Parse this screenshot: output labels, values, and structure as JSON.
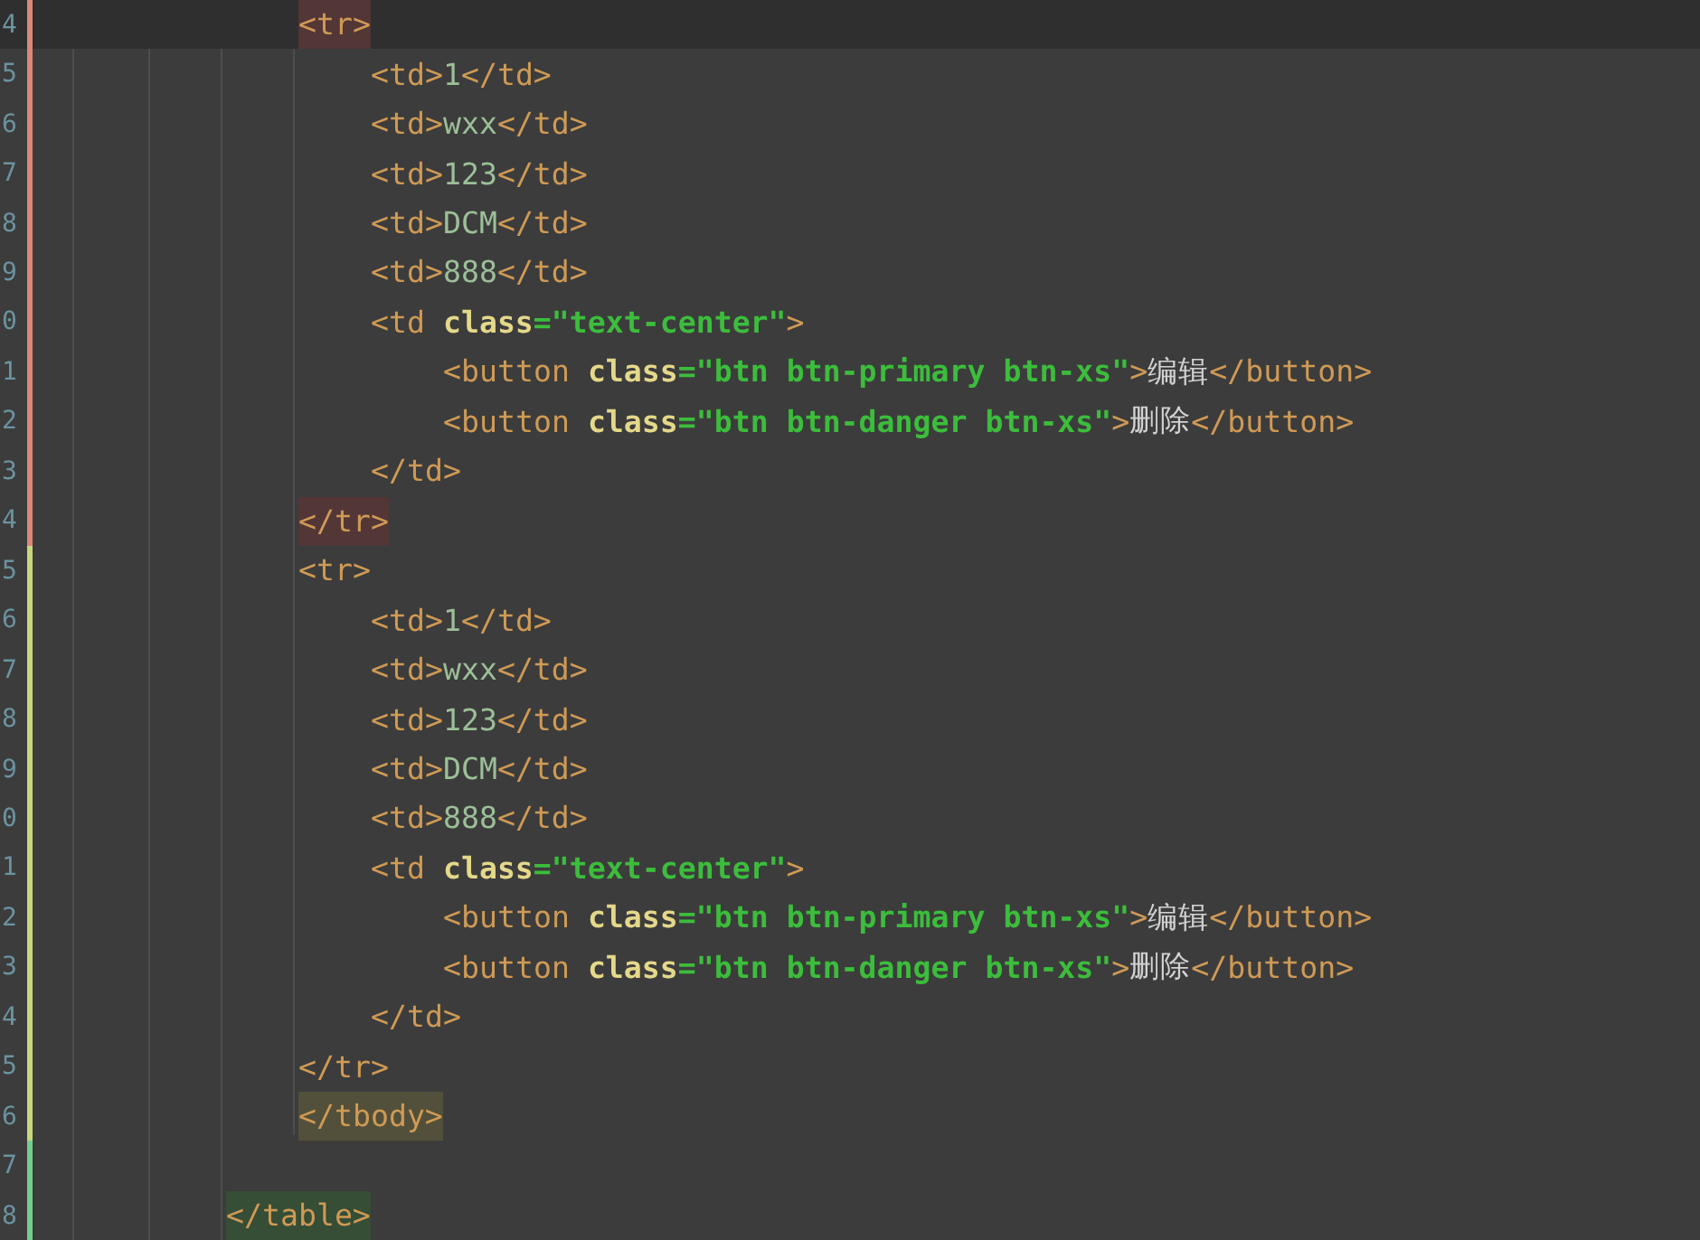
{
  "lines": [
    {
      "children": [
        {
          "number": "4",
          "color": "#d9887a",
          "current": true,
          "highlight": {
            "color": "#533636"
          },
          "tokens": [
            {
              "kind": "tag",
              "text": "<tr>"
            }
          ],
          "children": [
            {
              "number": "5",
              "color": "#d9887a",
              "current": false,
              "tokens": [
                {
                  "kind": "tag",
                  "text": "<td>"
                },
                {
                  "kind": "text",
                  "text": "1"
                },
                {
                  "kind": "tag",
                  "text": "</td>"
                }
              ]
            },
            {
              "number": "6",
              "color": "#d9887a",
              "current": false,
              "tokens": [
                {
                  "kind": "tag",
                  "text": "<td>"
                },
                {
                  "kind": "text",
                  "text": "wxx"
                },
                {
                  "kind": "tag",
                  "text": "</td>"
                }
              ]
            },
            {
              "number": "7",
              "color": "#d9887a",
              "current": false,
              "tokens": [
                {
                  "kind": "tag",
                  "text": "<td>"
                },
                {
                  "kind": "text",
                  "text": "123"
                },
                {
                  "kind": "tag",
                  "text": "</td>"
                }
              ]
            },
            {
              "number": "8",
              "color": "#d9887a",
              "current": false,
              "tokens": [
                {
                  "kind": "tag",
                  "text": "<td>"
                },
                {
                  "kind": "text",
                  "text": "DCM"
                },
                {
                  "kind": "tag",
                  "text": "</td>"
                }
              ]
            },
            {
              "number": "9",
              "color": "#d9887a",
              "current": false,
              "tokens": [
                {
                  "kind": "tag",
                  "text": "<td>"
                },
                {
                  "kind": "text",
                  "text": "888"
                },
                {
                  "kind": "tag",
                  "text": "</td>"
                }
              ]
            },
            {
              "number": "0",
              "color": "#d9887a",
              "current": false,
              "tokens": [
                {
                  "kind": "tag",
                  "text": "<td "
                },
                {
                  "kind": "attr",
                  "text": "class"
                },
                {
                  "kind": "string",
                  "text": "=\"text-center\""
                },
                {
                  "kind": "tag",
                  "text": ">"
                }
              ],
              "children": [
                {
                  "number": "1",
                  "color": "#d9887a",
                  "current": false,
                  "tokens": [
                    {
                      "kind": "tag",
                      "text": "<button "
                    },
                    {
                      "kind": "attr",
                      "text": "class"
                    },
                    {
                      "kind": "string",
                      "text": "=\"btn btn-primary btn-xs\""
                    },
                    {
                      "kind": "tag",
                      "text": ">"
                    },
                    {
                      "kind": "plain",
                      "text": "编辑"
                    },
                    {
                      "kind": "tag",
                      "text": "</button>"
                    }
                  ]
                },
                {
                  "number": "2",
                  "color": "#d9887a",
                  "current": false,
                  "tokens": [
                    {
                      "kind": "tag",
                      "text": "<button "
                    },
                    {
                      "kind": "attr",
                      "text": "class"
                    },
                    {
                      "kind": "string",
                      "text": "=\"btn btn-danger btn-xs\""
                    },
                    {
                      "kind": "tag",
                      "text": ">"
                    },
                    {
                      "kind": "plain",
                      "text": "删除"
                    },
                    {
                      "kind": "tag",
                      "text": "</button>"
                    }
                  ]
                }
              ]
            },
            {
              "number": "3",
              "color": "#d9887a",
              "current": false,
              "tokens": [
                {
                  "kind": "tag",
                  "text": "</td>"
                }
              ]
            }
          ]
        },
        {
          "number": "4",
          "color": "#d9887a",
          "current": false,
          "highlight": {
            "color": "#533636"
          },
          "tokens": [
            {
              "kind": "tag",
              "text": "</tr>"
            }
          ]
        },
        {
          "number": "5",
          "color": "#c9d67a",
          "current": false,
          "tokens": [
            {
              "kind": "tag",
              "text": "<tr>"
            }
          ],
          "children": [
            {
              "number": "6",
              "color": "#c9d67a",
              "current": false,
              "tokens": [
                {
                  "kind": "tag",
                  "text": "<td>"
                },
                {
                  "kind": "text",
                  "text": "1"
                },
                {
                  "kind": "tag",
                  "text": "</td>"
                }
              ]
            },
            {
              "number": "7",
              "color": "#c9d67a",
              "current": false,
              "tokens": [
                {
                  "kind": "tag",
                  "text": "<td>"
                },
                {
                  "kind": "text",
                  "text": "wxx"
                },
                {
                  "kind": "tag",
                  "text": "</td>"
                }
              ]
            },
            {
              "number": "8",
              "color": "#c9d67a",
              "current": false,
              "tokens": [
                {
                  "kind": "tag",
                  "text": "<td>"
                },
                {
                  "kind": "text",
                  "text": "123"
                },
                {
                  "kind": "tag",
                  "text": "</td>"
                }
              ]
            },
            {
              "number": "9",
              "color": "#c9d67a",
              "current": false,
              "tokens": [
                {
                  "kind": "tag",
                  "text": "<td>"
                },
                {
                  "kind": "text",
                  "text": "DCM"
                },
                {
                  "kind": "tag",
                  "text": "</td>"
                }
              ]
            },
            {
              "number": "0",
              "color": "#c9d67a",
              "current": false,
              "tokens": [
                {
                  "kind": "tag",
                  "text": "<td>"
                },
                {
                  "kind": "text",
                  "text": "888"
                },
                {
                  "kind": "tag",
                  "text": "</td>"
                }
              ]
            },
            {
              "number": "1",
              "color": "#c9d67a",
              "current": false,
              "tokens": [
                {
                  "kind": "tag",
                  "text": "<td "
                },
                {
                  "kind": "attr",
                  "text": "class"
                },
                {
                  "kind": "string",
                  "text": "=\"text-center\""
                },
                {
                  "kind": "tag",
                  "text": ">"
                }
              ],
              "children": [
                {
                  "number": "2",
                  "color": "#c9d67a",
                  "current": false,
                  "tokens": [
                    {
                      "kind": "tag",
                      "text": "<button "
                    },
                    {
                      "kind": "attr",
                      "text": "class"
                    },
                    {
                      "kind": "string",
                      "text": "=\"btn btn-primary btn-xs\""
                    },
                    {
                      "kind": "tag",
                      "text": ">"
                    },
                    {
                      "kind": "plain",
                      "text": "编辑"
                    },
                    {
                      "kind": "tag",
                      "text": "</button>"
                    }
                  ]
                },
                {
                  "number": "3",
                  "color": "#c9d67a",
                  "current": false,
                  "tokens": [
                    {
                      "kind": "tag",
                      "text": "<button "
                    },
                    {
                      "kind": "attr",
                      "text": "class"
                    },
                    {
                      "kind": "string",
                      "text": "=\"btn btn-danger btn-xs\""
                    },
                    {
                      "kind": "tag",
                      "text": ">"
                    },
                    {
                      "kind": "plain",
                      "text": "删除"
                    },
                    {
                      "kind": "tag",
                      "text": "</button>"
                    }
                  ]
                }
              ]
            },
            {
              "number": "4",
              "color": "#c9d67a",
              "current": false,
              "tokens": [
                {
                  "kind": "tag",
                  "text": "</td>"
                }
              ]
            }
          ]
        },
        {
          "number": "5",
          "color": "#c9d67a",
          "current": false,
          "tokens": [
            {
              "kind": "tag",
              "text": "</tr>"
            }
          ]
        },
        {
          "number": "6",
          "color": "#c9d67a",
          "current": false,
          "highlight": {
            "color": "#52503a"
          },
          "tokens": [
            {
              "kind": "tag",
              "text": "</tbody>"
            }
          ]
        }
      ]
    },
    {
      "number": "7",
      "color": "#6fd08c",
      "current": false
    },
    {
      "number": "8",
      "color": "#6fd08c",
      "current": false,
      "highlight": {
        "color": "#364d36"
      },
      "tokens": [
        {
          "kind": "tag",
          "text": "</table>"
        }
      ]
    }
  ]
}
